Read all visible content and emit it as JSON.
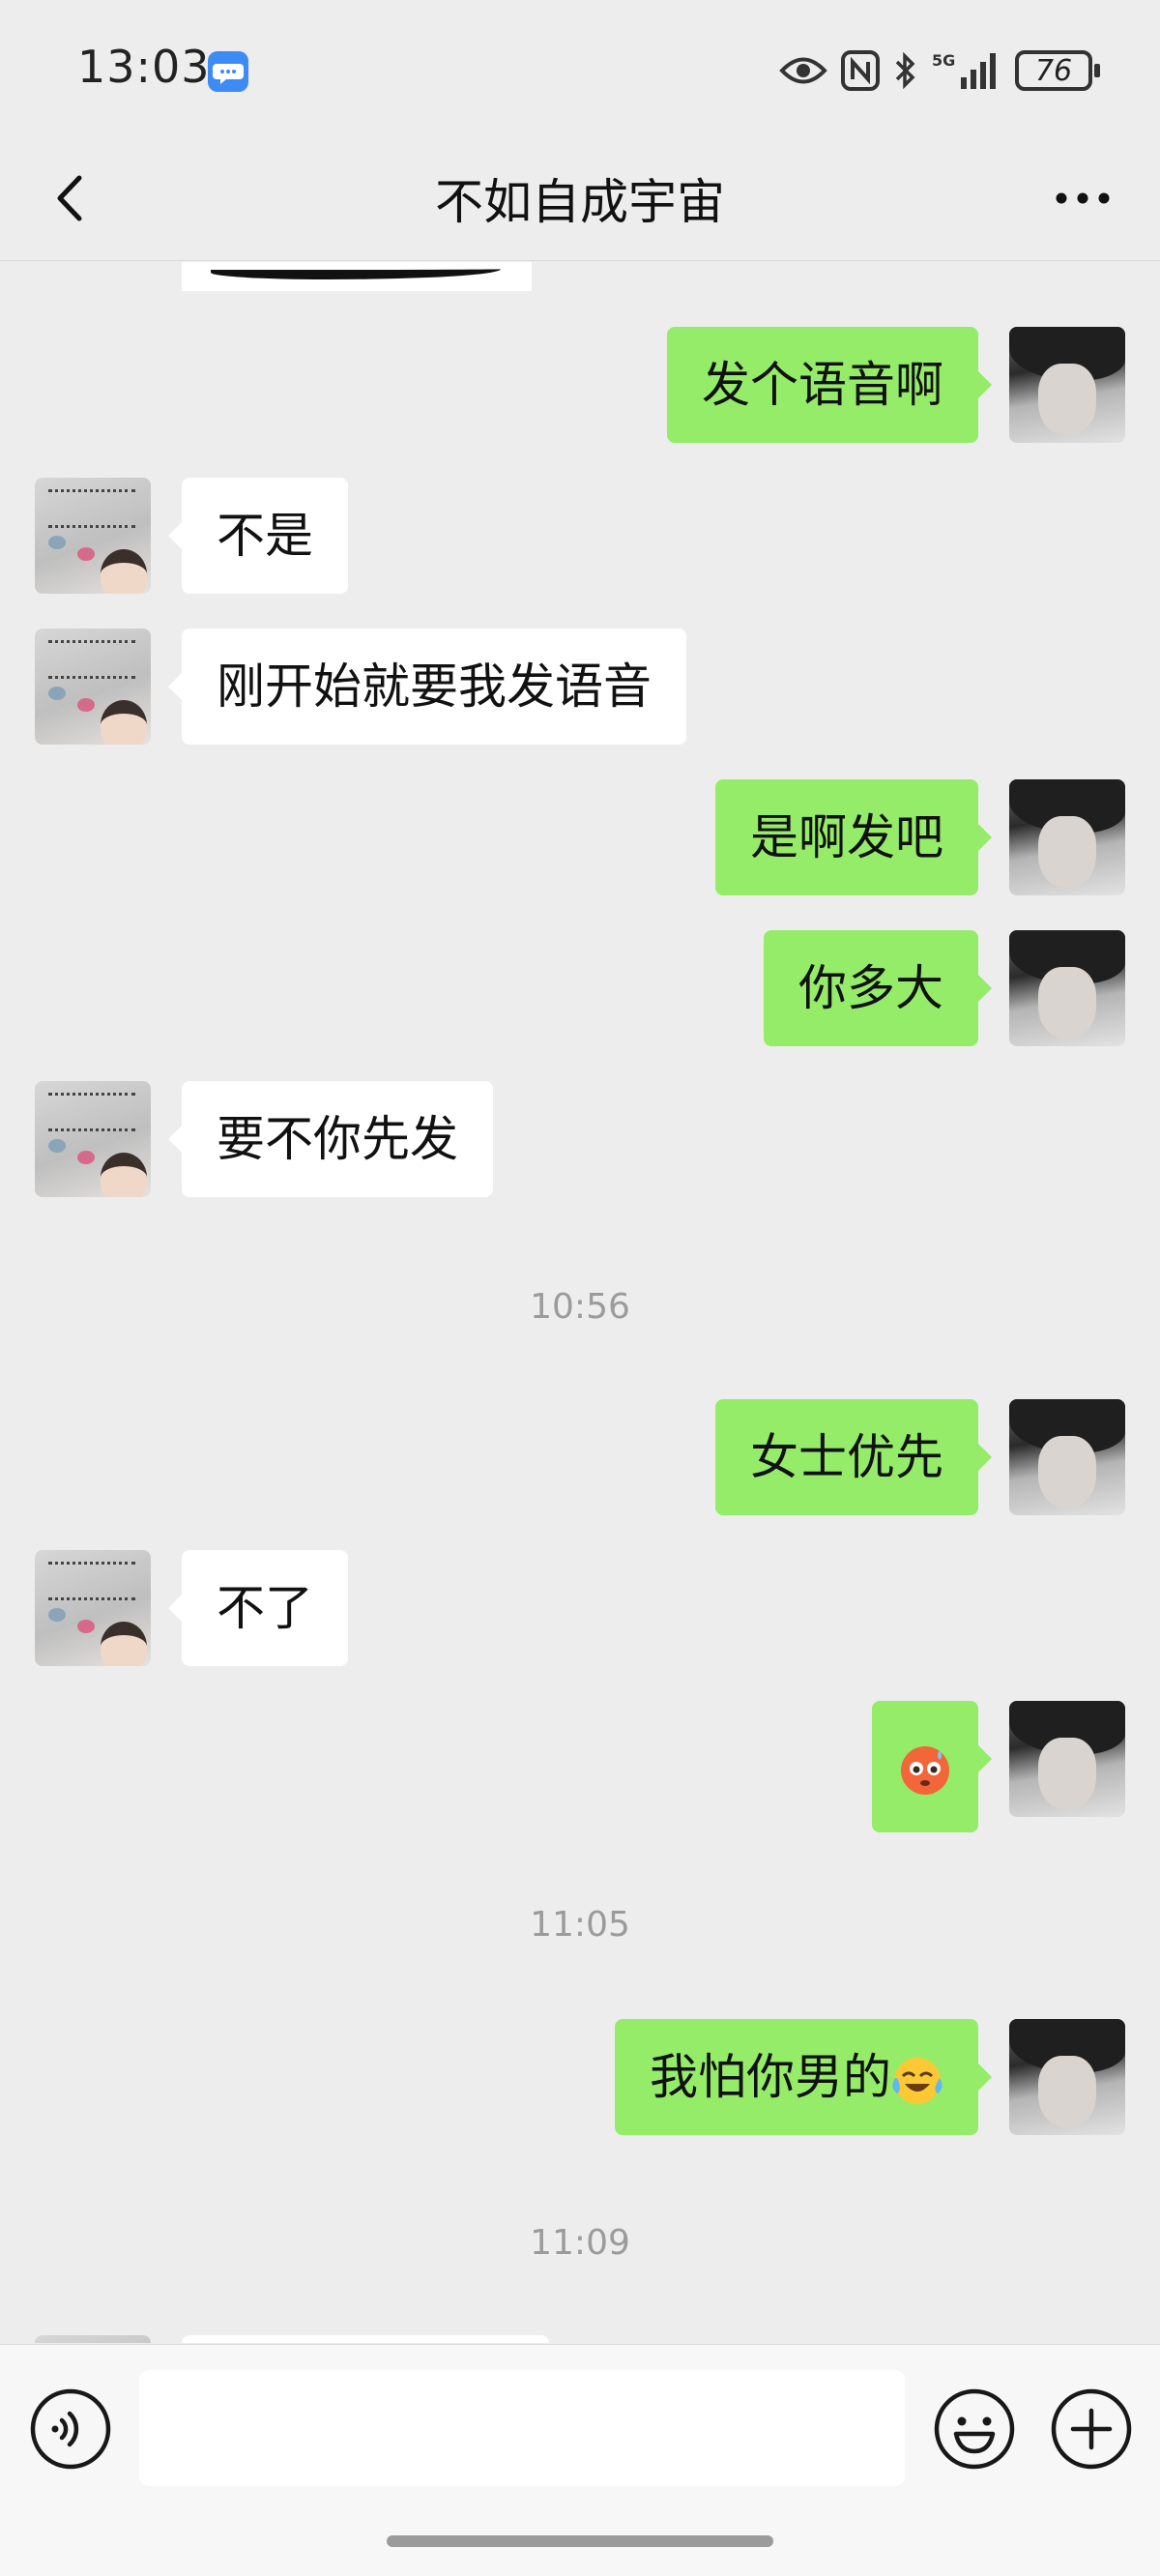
{
  "status_bar": {
    "time": "13:03",
    "icons": [
      "message-notification-icon",
      "eye-icon",
      "nfc-icon",
      "bluetooth-icon",
      "5g-signal-icon"
    ],
    "network": "5G",
    "battery": "76"
  },
  "nav": {
    "title": "不如自成宇宙",
    "back_icon": "chevron-left-icon",
    "more_icon": "more-dots-icon"
  },
  "messages": [
    {
      "side": "right",
      "text": "发个语音啊"
    },
    {
      "side": "left",
      "text": "不是"
    },
    {
      "side": "left",
      "text": "刚开始就要我发语音"
    },
    {
      "side": "right",
      "text": "是啊发吧"
    },
    {
      "side": "right",
      "text": "你多大"
    },
    {
      "side": "left",
      "text": "要不你先发"
    },
    {
      "side": "time",
      "text": "10:56"
    },
    {
      "side": "right",
      "text": "女士优先"
    },
    {
      "side": "left",
      "text": "不了"
    },
    {
      "side": "right",
      "emoji": "flushed-face-emoji"
    },
    {
      "side": "time",
      "text": "11:05"
    },
    {
      "side": "right",
      "text": "我怕你男的",
      "emoji": "laughing-tears-emoji"
    },
    {
      "side": "time",
      "text": "11:09"
    }
  ],
  "input_bar": {
    "voice_icon": "voice-input-icon",
    "input_value": "",
    "emoji_icon": "emoji-smiley-icon",
    "plus_icon": "plus-circle-icon"
  },
  "colors": {
    "background": "#ededed",
    "bubble_self": "#95ec69",
    "bubble_other": "#ffffff",
    "timestamp": "#9b9b9b"
  }
}
